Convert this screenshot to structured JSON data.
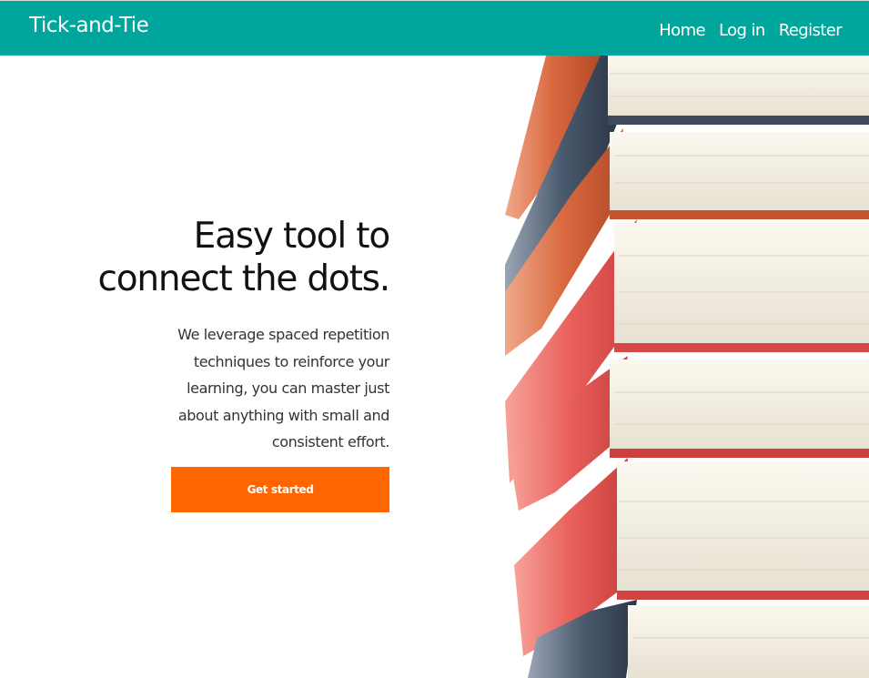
{
  "nav": {
    "brand": "Tick-and-Tie",
    "links": [
      "Home",
      "Log in",
      "Register"
    ]
  },
  "hero": {
    "headline_line1": "Easy tool to",
    "headline_line2": "connect the dots.",
    "description": "We leverage spaced repetition techniques to reinforce your learning, you can master just about anything with small and consistent effort.",
    "cta_label": "Get started",
    "image_icon": "stack-of-books-image"
  },
  "colors": {
    "navbar": "#00a59c",
    "cta": "#ff6600",
    "headline": "#111111",
    "body_text": "#333333"
  }
}
